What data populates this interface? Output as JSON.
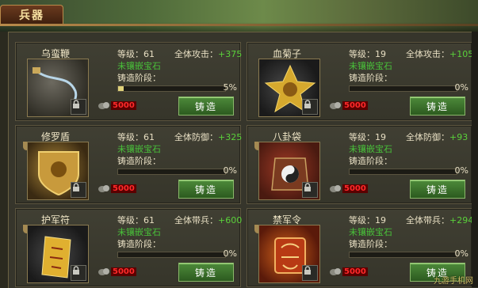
{
  "tab": {
    "label": "兵器"
  },
  "labels": {
    "level": "等级：",
    "unset_gem": "未镶嵌宝石",
    "forge_stage": "铸造阶段：",
    "forge_button": "铸造"
  },
  "cards": [
    {
      "name": "乌蛮鞭",
      "level": "61",
      "attr_label": "全体攻击：",
      "attr_value": "+375",
      "progress": 5,
      "progress_text": "5%",
      "cost": "5000",
      "image": "whip-icon",
      "border_color": "#8a7a50"
    },
    {
      "name": "血菊子",
      "level": "19",
      "attr_label": "全体攻击：",
      "attr_value": "+105",
      "progress": 0,
      "progress_text": "0%",
      "cost": "5000",
      "image": "gold-star-weapon-icon",
      "border_color": "#8a7a50"
    },
    {
      "name": "修罗盾",
      "level": "61",
      "attr_label": "全体防御：",
      "attr_value": "+325",
      "progress": 0,
      "progress_text": "0%",
      "cost": "5000",
      "image": "shield-icon",
      "border_color": "#8a7a50"
    },
    {
      "name": "八卦袋",
      "level": "19",
      "attr_label": "全体防御：",
      "attr_value": "+93",
      "progress": 0,
      "progress_text": "0%",
      "cost": "5000",
      "image": "bagua-pouch-icon",
      "border_color": "#8a7a50"
    },
    {
      "name": "护军符",
      "level": "61",
      "attr_label": "全体带兵：",
      "attr_value": "+600",
      "progress": 0,
      "progress_text": "0%",
      "cost": "5000",
      "image": "talisman-icon",
      "border_color": "#8a7a50"
    },
    {
      "name": "禁军令",
      "level": "19",
      "attr_label": "全体带兵：",
      "attr_value": "+294",
      "progress": 0,
      "progress_text": "0%",
      "cost": "5000",
      "image": "command-token-icon",
      "border_color": "#8a7a50"
    }
  ],
  "watermark": "九游手机网"
}
